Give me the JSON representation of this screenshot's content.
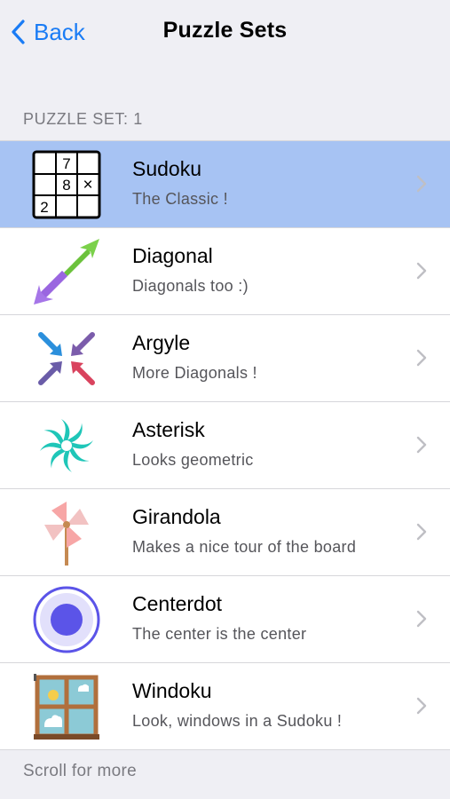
{
  "nav": {
    "back_label": "Back",
    "title": "Puzzle Sets"
  },
  "section": {
    "header": "PUZZLE SET: 1"
  },
  "puzzles": [
    {
      "name": "Sudoku",
      "description": "The Classic !",
      "icon": "sudoku-grid-icon",
      "selected": true
    },
    {
      "name": "Diagonal",
      "description": "Diagonals too :)",
      "icon": "diagonal-arrows-icon",
      "selected": false
    },
    {
      "name": "Argyle",
      "description": "More Diagonals !",
      "icon": "argyle-arrows-icon",
      "selected": false
    },
    {
      "name": "Asterisk",
      "description": "Looks geometric",
      "icon": "asterisk-swirl-icon",
      "selected": false
    },
    {
      "name": "Girandola",
      "description": "Makes a nice tour of the board",
      "icon": "pinwheel-icon",
      "selected": false
    },
    {
      "name": "Centerdot",
      "description": "The center is the center",
      "icon": "center-dot-icon",
      "selected": false
    },
    {
      "name": "Windoku",
      "description": "Look, windows in a Sudoku !",
      "icon": "window-icon",
      "selected": false
    }
  ],
  "sudoku_icon_digits": [
    "7",
    "8",
    "×",
    "2"
  ],
  "footer": "Scroll for more",
  "colors": {
    "accent": "#1a7cf5",
    "selected_row": "#a7c3f3",
    "background": "#efeff4"
  }
}
